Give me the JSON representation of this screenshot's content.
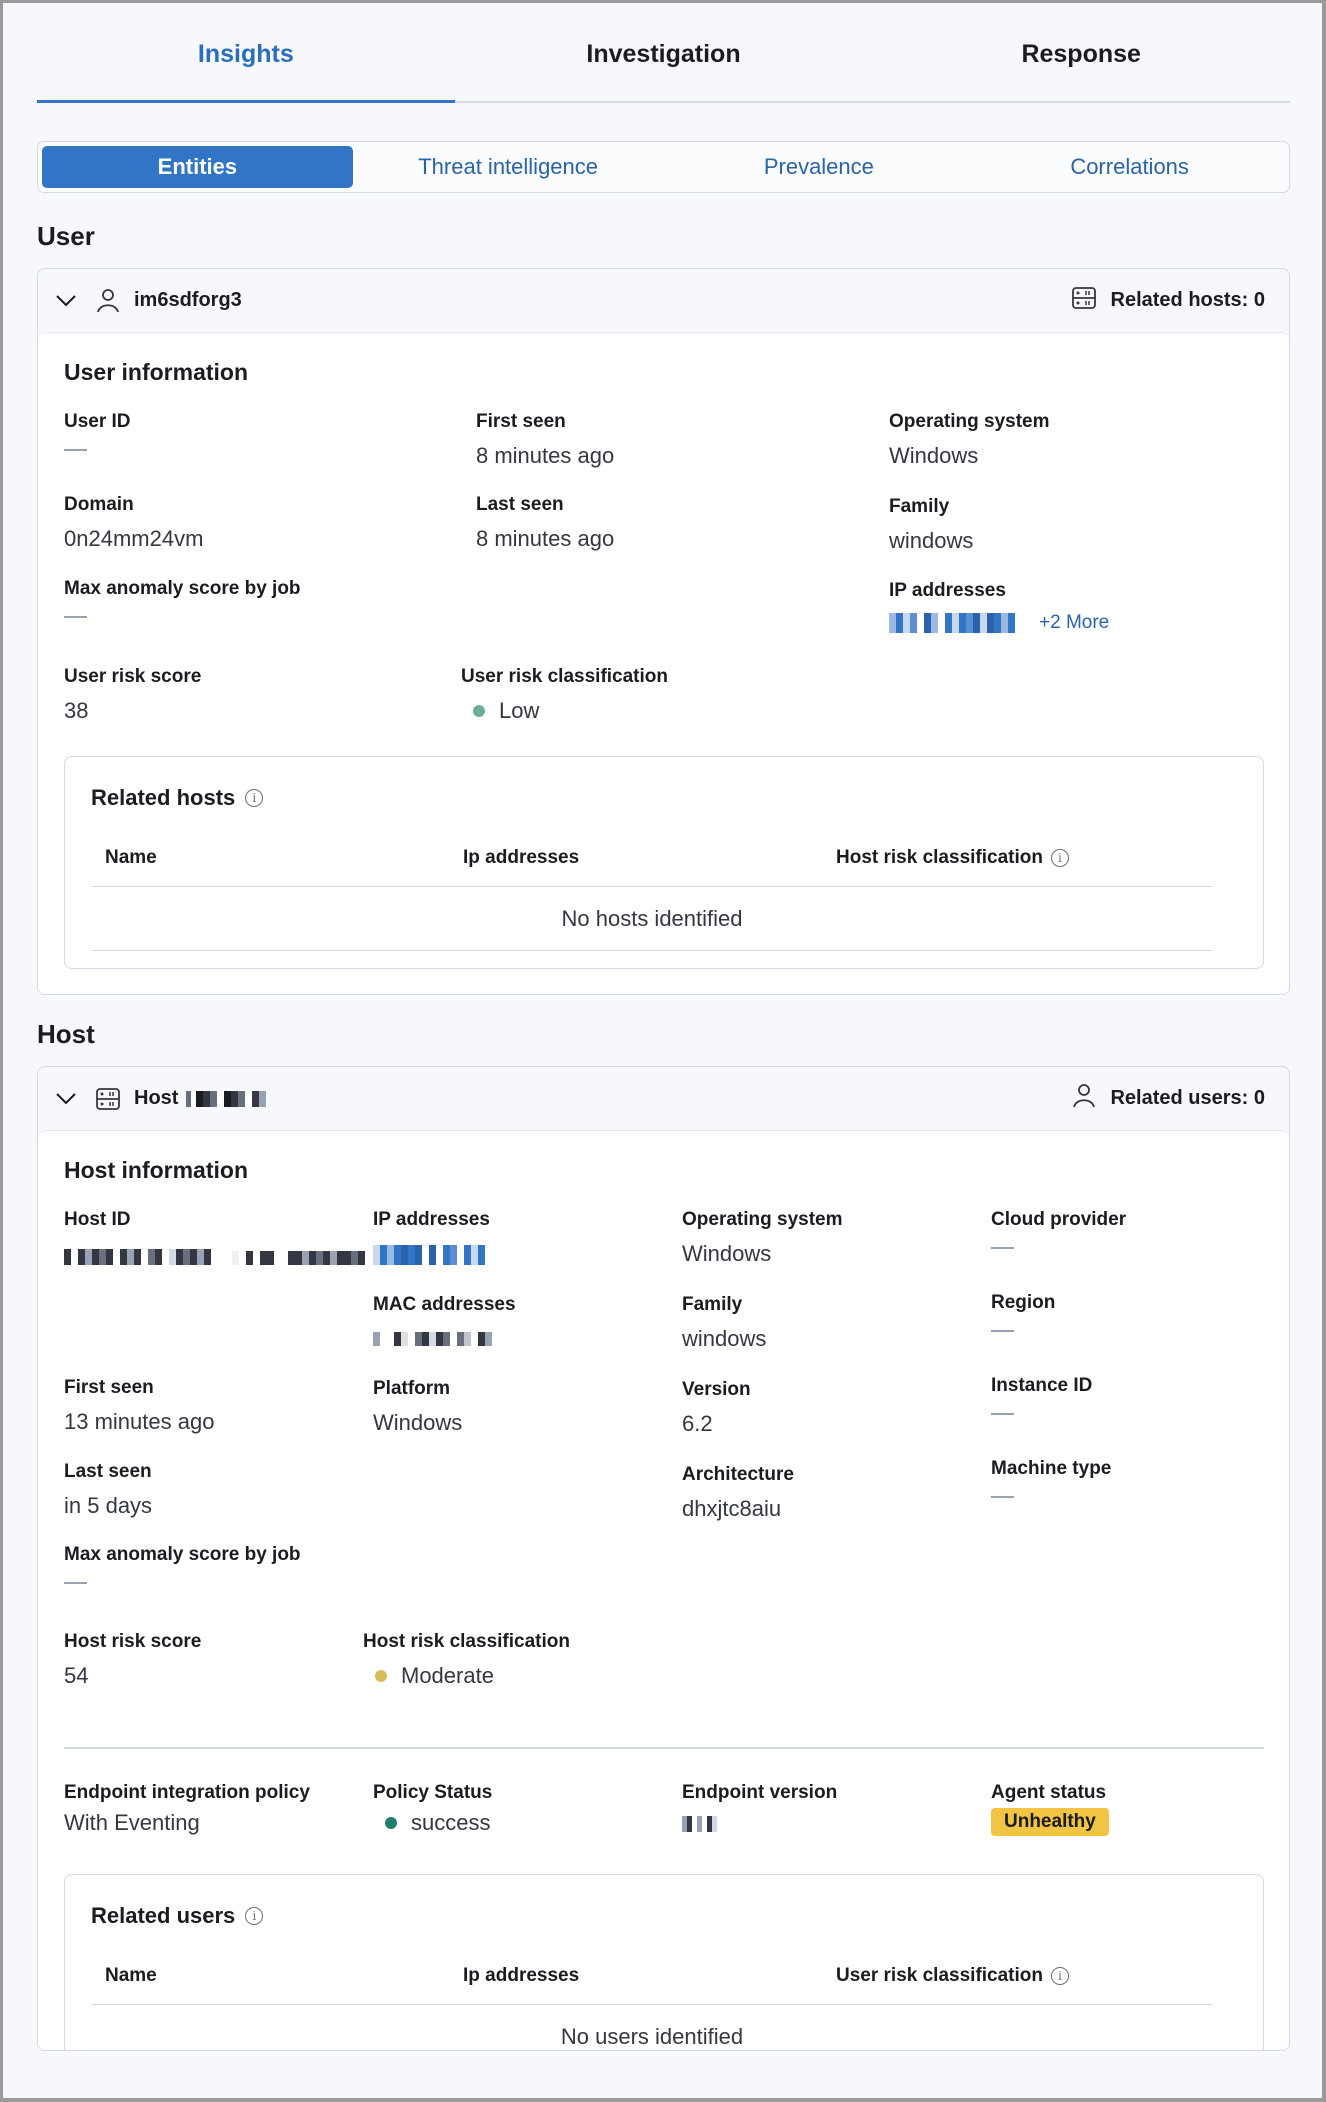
{
  "tabs": [
    {
      "label": "Insights",
      "active": true
    },
    {
      "label": "Investigation",
      "active": false
    },
    {
      "label": "Response",
      "active": false
    }
  ],
  "subtabs": [
    {
      "label": "Entities",
      "active": true
    },
    {
      "label": "Threat intelligence",
      "active": false
    },
    {
      "label": "Prevalence",
      "active": false
    },
    {
      "label": "Correlations",
      "active": false
    }
  ],
  "user_section": {
    "title": "User",
    "name": "im6sdforg3",
    "related_hosts_label": "Related hosts: 0",
    "info_title": "User information",
    "fields": {
      "user_id": {
        "label": "User ID",
        "value": "—"
      },
      "first_seen": {
        "label": "First seen",
        "value": "8 minutes ago"
      },
      "os": {
        "label": "Operating system",
        "value": "Windows"
      },
      "domain": {
        "label": "Domain",
        "value": "0n24mm24vm"
      },
      "last_seen": {
        "label": "Last seen",
        "value": "8 minutes ago"
      },
      "family": {
        "label": "Family",
        "value": "windows"
      },
      "max_anomaly": {
        "label": "Max anomaly score by job",
        "value": "—"
      },
      "ip": {
        "label": "IP addresses",
        "value": "[redacted]",
        "more": "+2 More"
      },
      "risk_score": {
        "label": "User risk score",
        "value": "38"
      },
      "risk_class": {
        "label": "User risk classification",
        "value": "Low",
        "color": "#6dae98"
      }
    },
    "related": {
      "title": "Related hosts",
      "columns": [
        "Name",
        "Ip addresses",
        "Host risk classification"
      ],
      "empty": "No hosts identified"
    }
  },
  "host_section": {
    "title": "Host",
    "name_prefix": "Host",
    "name": "[redacted]",
    "related_users_label": "Related users: 0",
    "info_title": "Host information",
    "fields": {
      "host_id": {
        "label": "Host ID",
        "value": "[redacted]"
      },
      "ip": {
        "label": "IP addresses",
        "value": "[redacted]"
      },
      "os": {
        "label": "Operating system",
        "value": "Windows"
      },
      "cloud_provider": {
        "label": "Cloud provider",
        "value": "—"
      },
      "mac": {
        "label": "MAC addresses",
        "value": "[redacted]"
      },
      "family": {
        "label": "Family",
        "value": "windows"
      },
      "region": {
        "label": "Region",
        "value": "—"
      },
      "first_seen": {
        "label": "First seen",
        "value": "13 minutes ago"
      },
      "platform": {
        "label": "Platform",
        "value": "Windows"
      },
      "version": {
        "label": "Version",
        "value": "6.2"
      },
      "instance_id": {
        "label": "Instance ID",
        "value": "—"
      },
      "last_seen": {
        "label": "Last seen",
        "value": "in 5 days"
      },
      "architecture": {
        "label": "Architecture",
        "value": "dhxjtc8aiu"
      },
      "machine_type": {
        "label": "Machine type",
        "value": "—"
      },
      "max_anomaly": {
        "label": "Max anomaly score by job",
        "value": "—"
      },
      "risk_score": {
        "label": "Host risk score",
        "value": "54"
      },
      "risk_class": {
        "label": "Host risk classification",
        "value": "Moderate",
        "color": "#d6bf57"
      },
      "endpoint_policy": {
        "label": "Endpoint integration policy",
        "value": "With Eventing"
      },
      "policy_status": {
        "label": "Policy Status",
        "value": "success",
        "color": "#207f6c"
      },
      "endpoint_version": {
        "label": "Endpoint version",
        "value": "[redacted]"
      },
      "agent_status": {
        "label": "Agent status",
        "value": "Unhealthy",
        "color": "#f1c443"
      }
    },
    "related": {
      "title": "Related users",
      "columns": [
        "Name",
        "Ip addresses",
        "User risk classification"
      ],
      "empty": "No users identified"
    }
  }
}
